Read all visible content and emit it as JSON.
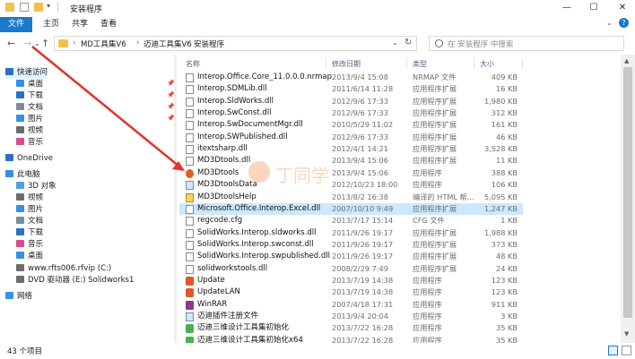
{
  "window": {
    "title": "安装程序",
    "minimize": "—",
    "maximize": "☐",
    "close": "✕"
  },
  "ribbon": {
    "tabs": [
      "文件",
      "主页",
      "共享",
      "查看"
    ]
  },
  "address": {
    "crumbs": [
      "MD工具集V6",
      "迈迪工具集V6",
      "安装程序"
    ],
    "search_placeholder": "在 安装程序 中搜索"
  },
  "sidebar": {
    "items": [
      {
        "label": "快速访问",
        "icon": "star-icon",
        "pinned": false
      },
      {
        "label": "桌面",
        "icon": "desktop-icon",
        "pinned": true
      },
      {
        "label": "下载",
        "icon": "download-icon",
        "pinned": true
      },
      {
        "label": "文档",
        "icon": "document-icon",
        "pinned": true
      },
      {
        "label": "图片",
        "icon": "picture-icon",
        "pinned": true
      },
      {
        "label": "视频",
        "icon": "video-icon",
        "pinned": false
      },
      {
        "label": "音乐",
        "icon": "music-icon",
        "pinned": false
      },
      {
        "label": "OneDrive",
        "icon": "cloud-icon",
        "pinned": false
      },
      {
        "label": "此电脑",
        "icon": "pc-icon",
        "pinned": false
      },
      {
        "label": "3D 对象",
        "icon": "cube-icon",
        "pinned": false
      },
      {
        "label": "视频",
        "icon": "video-icon",
        "pinned": false
      },
      {
        "label": "图片",
        "icon": "picture-icon",
        "pinned": false
      },
      {
        "label": "文档",
        "icon": "document-icon",
        "pinned": false
      },
      {
        "label": "下载",
        "icon": "download-icon",
        "pinned": false
      },
      {
        "label": "音乐",
        "icon": "music-icon",
        "pinned": false
      },
      {
        "label": "桌面",
        "icon": "desktop-icon",
        "pinned": false
      },
      {
        "label": "www.rfts006.rfvip (C:)",
        "icon": "drive-icon",
        "pinned": false
      },
      {
        "label": "DVD 驱动器 (E:) Solidworks1",
        "icon": "dvd-icon",
        "pinned": false
      },
      {
        "label": "网络",
        "icon": "network-icon",
        "pinned": false
      }
    ]
  },
  "columns": {
    "name": "名称",
    "date": "修改日期",
    "type": "类型",
    "size": "大小"
  },
  "files": [
    {
      "name": "Interop.Office.Core_11.0.0.0.nrmap",
      "date": "2013/9/4 15:08",
      "type": "NRMAP 文件",
      "size": "409 KB",
      "icon": "file-icon"
    },
    {
      "name": "Interop.SDMLib.dll",
      "date": "2011/6/14 11:28",
      "type": "应用程序扩展",
      "size": "16 KB",
      "icon": "dll-icon"
    },
    {
      "name": "Interop.SldWorks.dll",
      "date": "2012/9/6 17:33",
      "type": "应用程序扩展",
      "size": "1,980 KB",
      "icon": "dll-icon"
    },
    {
      "name": "Interop.SwConst.dll",
      "date": "2012/9/6 17:33",
      "type": "应用程序扩展",
      "size": "312 KB",
      "icon": "dll-icon"
    },
    {
      "name": "Interop.SwDocumentMgr.dll",
      "date": "2010/5/29 11:02",
      "type": "应用程序扩展",
      "size": "161 KB",
      "icon": "dll-icon"
    },
    {
      "name": "Interop.SWPublished.dll",
      "date": "2012/9/6 17:33",
      "type": "应用程序扩展",
      "size": "46 KB",
      "icon": "dll-icon"
    },
    {
      "name": "itextsharp.dll",
      "date": "2012/4/1 14:21",
      "type": "应用程序扩展",
      "size": "3,528 KB",
      "icon": "dll-icon"
    },
    {
      "name": "MD3Dtools.dll",
      "date": "2013/9/4 15:06",
      "type": "应用程序扩展",
      "size": "11 KB",
      "icon": "dll-icon"
    },
    {
      "name": "MD3Dtools",
      "date": "2013/9/4 15:06",
      "type": "应用程序",
      "size": "388 KB",
      "icon": "app-orange-icon"
    },
    {
      "name": "MD3DtoolsData",
      "date": "2012/10/23 18:00",
      "type": "应用程序",
      "size": "106 KB",
      "icon": "app-icon"
    },
    {
      "name": "MD3DtoolsHelp",
      "date": "2013/8/2 16:38",
      "type": "编译的 HTML 帮...",
      "size": "5,095 KB",
      "icon": "help-icon"
    },
    {
      "name": "Microsoft.Office.Interop.Excel.dll",
      "date": "2007/10/10 9:49",
      "type": "应用程序扩展",
      "size": "1,247 KB",
      "icon": "dll-icon"
    },
    {
      "name": "regcode.cfg",
      "date": "2013/7/17 15:14",
      "type": "CFG 文件",
      "size": "1 KB",
      "icon": "file-icon"
    },
    {
      "name": "SolidWorks.Interop.sldworks.dll",
      "date": "2011/9/26 19:17",
      "type": "应用程序扩展",
      "size": "1,988 KB",
      "icon": "dll-icon"
    },
    {
      "name": "SolidWorks.Interop.swconst.dll",
      "date": "2011/9/26 19:17",
      "type": "应用程序扩展",
      "size": "373 KB",
      "icon": "dll-icon"
    },
    {
      "name": "SolidWorks.Interop.swpublished.dll",
      "date": "2011/9/26 19:17",
      "type": "应用程序扩展",
      "size": "48 KB",
      "icon": "dll-icon"
    },
    {
      "name": "solidworkstools.dll",
      "date": "2008/2/29 7:49",
      "type": "应用程序扩展",
      "size": "24 KB",
      "icon": "dll-icon"
    },
    {
      "name": "Update",
      "date": "2013/7/19 14:38",
      "type": "应用程序",
      "size": "123 KB",
      "icon": "update-icon"
    },
    {
      "name": "UpdateLAN",
      "date": "2013/7/19 14:38",
      "type": "应用程序",
      "size": "123 KB",
      "icon": "update-icon"
    },
    {
      "name": "WinRAR",
      "date": "2007/4/18 17:31",
      "type": "应用程序",
      "size": "911 KB",
      "icon": "winrar-icon"
    },
    {
      "name": "迈迪插件注册文件",
      "date": "2013/9/4 20:04",
      "type": "应用程序",
      "size": "3 KB",
      "icon": "app-icon"
    },
    {
      "name": "迈迪三维设计工具集初始化",
      "date": "2013/7/22 16:28",
      "type": "应用程序",
      "size": "35 KB",
      "icon": "green-app-icon"
    },
    {
      "name": "迈迪三维设计工具集初始化x64",
      "date": "2013/7/22 16:28",
      "type": "应用程序",
      "size": "35 KB",
      "icon": "green-app-icon"
    }
  ],
  "selected_file": "Microsoft.Office.Interop.Excel.dll",
  "watermark": "丁同学",
  "status": {
    "item_count": "43 个项目"
  },
  "colors": {
    "accent": "#1979ca",
    "selection": "#cce8ff",
    "arrow": "#e5322d"
  }
}
